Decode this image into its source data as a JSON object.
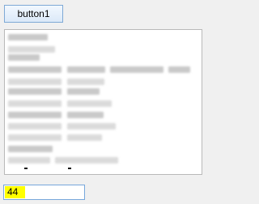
{
  "toolbar": {
    "button_label": "button1"
  },
  "bottom_input": {
    "value": "44"
  }
}
